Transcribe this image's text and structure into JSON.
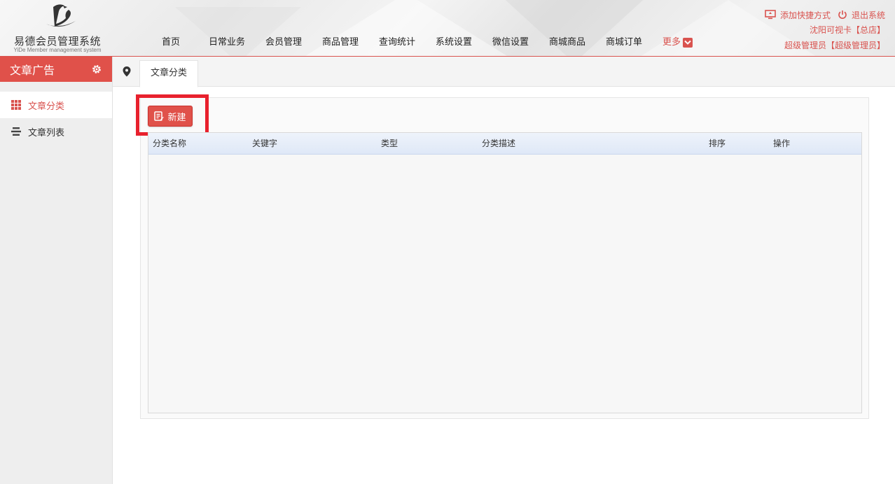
{
  "header": {
    "logo_title": "易德会员管理系统",
    "logo_subtitle": "YiDe Member management system",
    "nav": [
      {
        "label": "首页"
      },
      {
        "label": "日常业务"
      },
      {
        "label": "会员管理"
      },
      {
        "label": "商品管理"
      },
      {
        "label": "查询统计"
      },
      {
        "label": "系统设置"
      },
      {
        "label": "微信设置"
      },
      {
        "label": "商城商品"
      },
      {
        "label": "商城订单"
      }
    ],
    "more_label": "更多",
    "add_shortcut": "添加快捷方式",
    "logout": "退出系统",
    "store": "沈阳可视卡【总店】",
    "user": "超级管理员【超级管理员】"
  },
  "sidebar": {
    "title": "文章广告",
    "items": [
      {
        "label": "文章分类",
        "active": true
      },
      {
        "label": "文章列表",
        "active": false
      }
    ]
  },
  "tabs": {
    "active": "文章分类"
  },
  "toolbar": {
    "new_label": "新建"
  },
  "table": {
    "columns": [
      "分类名称",
      "关键字",
      "类型",
      "分类描述",
      "排序",
      "操作"
    ],
    "rows": []
  },
  "colors": {
    "accent": "#e0514a",
    "highlight": "#e8212d"
  }
}
